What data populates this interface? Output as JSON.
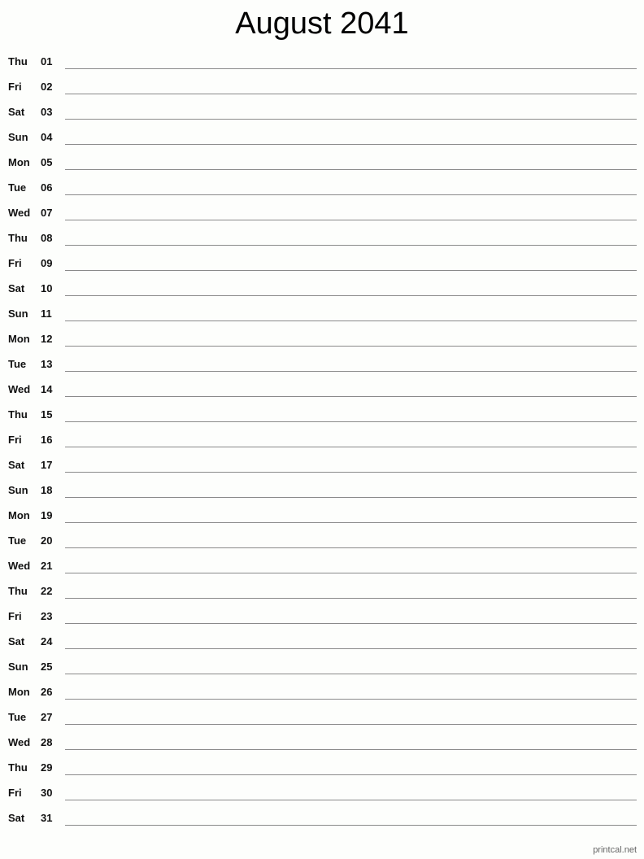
{
  "title": "August 2041",
  "days": [
    {
      "dow": "Thu",
      "num": "01"
    },
    {
      "dow": "Fri",
      "num": "02"
    },
    {
      "dow": "Sat",
      "num": "03"
    },
    {
      "dow": "Sun",
      "num": "04"
    },
    {
      "dow": "Mon",
      "num": "05"
    },
    {
      "dow": "Tue",
      "num": "06"
    },
    {
      "dow": "Wed",
      "num": "07"
    },
    {
      "dow": "Thu",
      "num": "08"
    },
    {
      "dow": "Fri",
      "num": "09"
    },
    {
      "dow": "Sat",
      "num": "10"
    },
    {
      "dow": "Sun",
      "num": "11"
    },
    {
      "dow": "Mon",
      "num": "12"
    },
    {
      "dow": "Tue",
      "num": "13"
    },
    {
      "dow": "Wed",
      "num": "14"
    },
    {
      "dow": "Thu",
      "num": "15"
    },
    {
      "dow": "Fri",
      "num": "16"
    },
    {
      "dow": "Sat",
      "num": "17"
    },
    {
      "dow": "Sun",
      "num": "18"
    },
    {
      "dow": "Mon",
      "num": "19"
    },
    {
      "dow": "Tue",
      "num": "20"
    },
    {
      "dow": "Wed",
      "num": "21"
    },
    {
      "dow": "Thu",
      "num": "22"
    },
    {
      "dow": "Fri",
      "num": "23"
    },
    {
      "dow": "Sat",
      "num": "24"
    },
    {
      "dow": "Sun",
      "num": "25"
    },
    {
      "dow": "Mon",
      "num": "26"
    },
    {
      "dow": "Tue",
      "num": "27"
    },
    {
      "dow": "Wed",
      "num": "28"
    },
    {
      "dow": "Thu",
      "num": "29"
    },
    {
      "dow": "Fri",
      "num": "30"
    },
    {
      "dow": "Sat",
      "num": "31"
    }
  ],
  "footer": "printcal.net"
}
